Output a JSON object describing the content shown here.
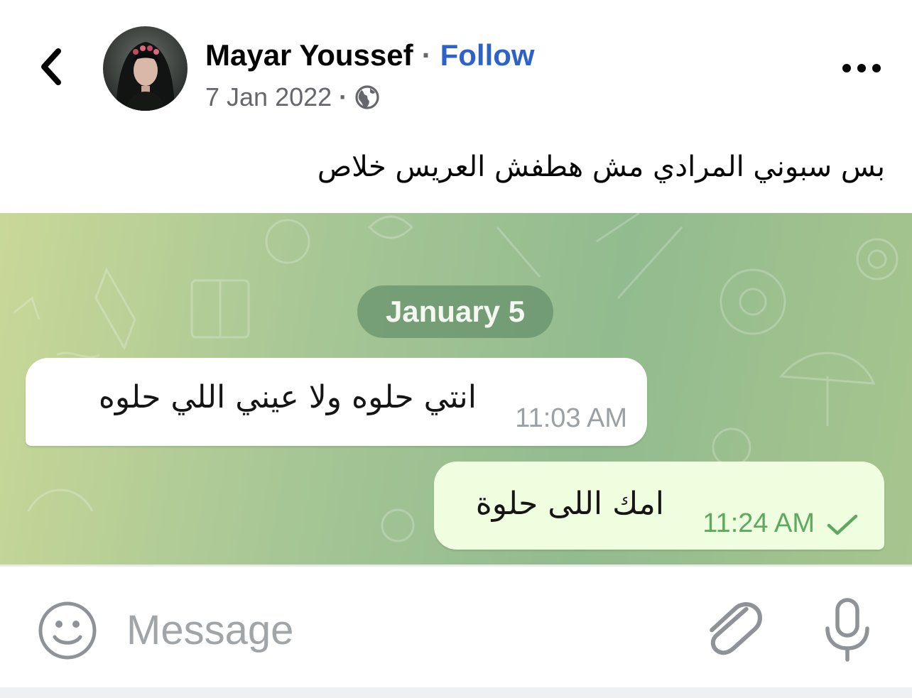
{
  "post": {
    "author_name": "Mayar Youssef",
    "separator": "·",
    "follow_label": "Follow",
    "date": "7 Jan 2022",
    "meta_separator": "·",
    "audience_icon": "globe-icon",
    "text": "بس سبوني المرادي مش هطفش العريس خلاص"
  },
  "chat": {
    "date_label": "January 5",
    "messages": [
      {
        "direction": "incoming",
        "text": "انتي حلوه ولا عيني اللي حلوه",
        "time": "11:03 AM"
      },
      {
        "direction": "outgoing",
        "text": "امك اللى حلوة",
        "time": "11:24 AM",
        "status_icon": "check-icon"
      }
    ],
    "input_placeholder": "Message",
    "input_value": ""
  },
  "colors": {
    "follow_link": "#2d62c8",
    "outgoing_bubble": "#eefedf",
    "outgoing_time": "#5ea860",
    "incoming_time": "#9aa0a6",
    "chat_background": "#a6c695"
  },
  "icons": {
    "back": "chevron-left-icon",
    "more": "more-dots-icon",
    "emoji": "smiley-icon",
    "attach": "paperclip-icon",
    "mic": "microphone-icon"
  }
}
